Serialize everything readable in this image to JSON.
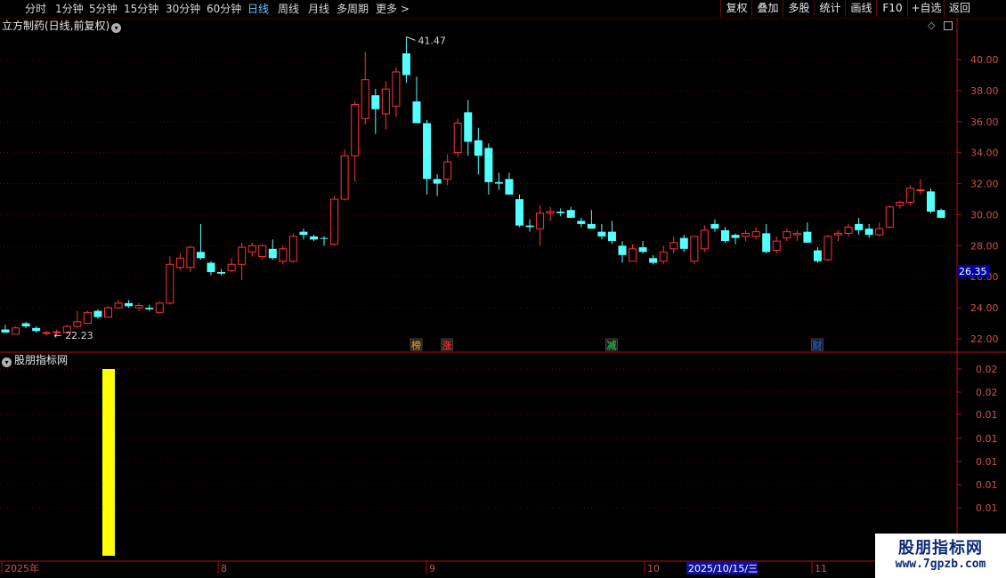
{
  "toolbar": {
    "periods": [
      "分时",
      "1分钟",
      "5分钟",
      "15分钟",
      "30分钟",
      "60分钟",
      "日线",
      "周线",
      "月线",
      "多周期",
      "更多"
    ],
    "more_arrow": ">",
    "selected_period": "日线",
    "right_buttons": [
      "复权",
      "叠加",
      "多股",
      "统计",
      "画线",
      "F10",
      "+自选",
      "返回"
    ]
  },
  "chart_header": {
    "title": "立方制药(日线,前复权)",
    "dropdown_icon": "chevron-down-icon"
  },
  "price_axis": {
    "ticks": [
      "40.00",
      "38.00",
      "36.00",
      "34.00",
      "32.00",
      "30.00",
      "28.00",
      "26.00",
      "24.00",
      "22.00"
    ],
    "current_price_label": "26.35"
  },
  "annotations": {
    "high_label": "41.47",
    "low_label": "22.23",
    "event_markers": [
      "榜",
      "涨",
      "减",
      "财"
    ]
  },
  "indicator_panel": {
    "title": "股朋指标网",
    "axis_ticks": [
      "0.02",
      "0.02",
      "0.01",
      "0.01",
      "0.01",
      "0.01",
      "0.01"
    ]
  },
  "time_axis": {
    "labels": [
      "2025年",
      "8",
      "9",
      "10",
      "11"
    ],
    "cursor_date": "2025/10/15/三"
  },
  "watermark": {
    "line1": "股朋指标网",
    "line2": "www.7gpzb.com"
  },
  "colors": {
    "up": "#ff3333",
    "down": "#54ffff",
    "grid": "#6a0000",
    "indicator_bar": "#ffff00",
    "current_price_bg": "#0000a8"
  },
  "chart_data": {
    "type": "candlestick",
    "title": "立方制药(日线,前复权)",
    "ylim": [
      21.2,
      42.5
    ],
    "yticks": [
      22,
      24,
      26,
      28,
      30,
      32,
      34,
      36,
      38,
      40
    ],
    "x_labels": [
      "2025年",
      "8",
      "9",
      "10",
      "11"
    ],
    "candles": [
      {
        "o": 22.6,
        "h": 22.9,
        "l": 22.4,
        "c": 22.4
      },
      {
        "o": 22.3,
        "h": 22.8,
        "l": 22.3,
        "c": 22.7
      },
      {
        "o": 23.0,
        "h": 23.1,
        "l": 22.7,
        "c": 22.8
      },
      {
        "o": 22.7,
        "h": 22.8,
        "l": 22.4,
        "c": 22.5
      },
      {
        "o": 22.4,
        "h": 22.5,
        "l": 22.23,
        "c": 22.4
      },
      {
        "o": 22.4,
        "h": 22.6,
        "l": 22.23,
        "c": 22.45
      },
      {
        "o": 22.4,
        "h": 22.9,
        "l": 22.3,
        "c": 22.8
      },
      {
        "o": 22.8,
        "h": 23.8,
        "l": 22.7,
        "c": 23.1
      },
      {
        "o": 23.0,
        "h": 23.8,
        "l": 23.0,
        "c": 23.7
      },
      {
        "o": 23.8,
        "h": 23.9,
        "l": 23.3,
        "c": 23.4
      },
      {
        "o": 23.4,
        "h": 24.1,
        "l": 23.4,
        "c": 24.0
      },
      {
        "o": 24.0,
        "h": 24.5,
        "l": 23.9,
        "c": 24.3
      },
      {
        "o": 24.3,
        "h": 24.5,
        "l": 24.0,
        "c": 24.1
      },
      {
        "o": 24.0,
        "h": 24.3,
        "l": 23.8,
        "c": 24.15
      },
      {
        "o": 24.0,
        "h": 24.2,
        "l": 23.8,
        "c": 23.9
      },
      {
        "o": 23.7,
        "h": 24.4,
        "l": 23.7,
        "c": 24.3
      },
      {
        "o": 24.3,
        "h": 27.3,
        "l": 24.2,
        "c": 26.8
      },
      {
        "o": 26.6,
        "h": 27.5,
        "l": 26.4,
        "c": 27.2
      },
      {
        "o": 26.6,
        "h": 28.0,
        "l": 26.3,
        "c": 27.9
      },
      {
        "o": 27.6,
        "h": 29.4,
        "l": 27.1,
        "c": 27.2
      },
      {
        "o": 26.9,
        "h": 27.0,
        "l": 26.1,
        "c": 26.3
      },
      {
        "o": 26.3,
        "h": 26.5,
        "l": 26.1,
        "c": 26.2
      },
      {
        "o": 26.4,
        "h": 27.2,
        "l": 26.3,
        "c": 26.8
      },
      {
        "o": 26.8,
        "h": 28.2,
        "l": 25.8,
        "c": 27.9
      },
      {
        "o": 27.6,
        "h": 28.2,
        "l": 27.3,
        "c": 28.0
      },
      {
        "o": 27.3,
        "h": 28.1,
        "l": 27.1,
        "c": 28.0
      },
      {
        "o": 27.8,
        "h": 28.4,
        "l": 27.1,
        "c": 27.2
      },
      {
        "o": 27.0,
        "h": 28.0,
        "l": 26.8,
        "c": 27.8
      },
      {
        "o": 27.0,
        "h": 28.8,
        "l": 26.9,
        "c": 28.6
      },
      {
        "o": 28.9,
        "h": 29.1,
        "l": 28.4,
        "c": 28.7
      },
      {
        "o": 28.6,
        "h": 28.7,
        "l": 28.3,
        "c": 28.4
      },
      {
        "o": 28.5,
        "h": 28.6,
        "l": 28.0,
        "c": 28.45
      },
      {
        "o": 28.1,
        "h": 31.2,
        "l": 28.0,
        "c": 31.0
      },
      {
        "o": 31.0,
        "h": 34.2,
        "l": 30.9,
        "c": 33.8
      },
      {
        "o": 33.8,
        "h": 37.3,
        "l": 32.1,
        "c": 37.1
      },
      {
        "o": 36.2,
        "h": 40.5,
        "l": 35.8,
        "c": 38.7
      },
      {
        "o": 37.7,
        "h": 38.1,
        "l": 35.2,
        "c": 36.8
      },
      {
        "o": 36.5,
        "h": 38.6,
        "l": 35.5,
        "c": 38.1
      },
      {
        "o": 37.0,
        "h": 39.5,
        "l": 36.3,
        "c": 39.2
      },
      {
        "o": 40.4,
        "h": 41.47,
        "l": 38.5,
        "c": 39.0
      },
      {
        "o": 37.3,
        "h": 38.9,
        "l": 36.3,
        "c": 35.9
      },
      {
        "o": 35.9,
        "h": 36.1,
        "l": 31.3,
        "c": 32.3
      },
      {
        "o": 32.3,
        "h": 32.6,
        "l": 31.2,
        "c": 32.0
      },
      {
        "o": 32.3,
        "h": 33.9,
        "l": 31.9,
        "c": 33.4
      },
      {
        "o": 34.0,
        "h": 36.2,
        "l": 33.7,
        "c": 35.9
      },
      {
        "o": 36.6,
        "h": 37.4,
        "l": 33.8,
        "c": 34.7
      },
      {
        "o": 34.8,
        "h": 35.6,
        "l": 32.6,
        "c": 33.8
      },
      {
        "o": 34.3,
        "h": 34.6,
        "l": 31.3,
        "c": 32.1
      },
      {
        "o": 32.1,
        "h": 32.7,
        "l": 31.6,
        "c": 32.0
      },
      {
        "o": 32.3,
        "h": 32.7,
        "l": 31.3,
        "c": 31.3
      },
      {
        "o": 31.0,
        "h": 31.3,
        "l": 29.2,
        "c": 29.3
      },
      {
        "o": 29.3,
        "h": 29.7,
        "l": 28.9,
        "c": 29.2
      },
      {
        "o": 29.1,
        "h": 30.6,
        "l": 28.0,
        "c": 30.1
      },
      {
        "o": 30.1,
        "h": 30.5,
        "l": 29.6,
        "c": 30.2
      },
      {
        "o": 30.2,
        "h": 30.4,
        "l": 29.9,
        "c": 30.1
      },
      {
        "o": 30.3,
        "h": 30.5,
        "l": 29.8,
        "c": 29.8
      },
      {
        "o": 29.6,
        "h": 29.8,
        "l": 29.2,
        "c": 29.4
      },
      {
        "o": 29.4,
        "h": 30.3,
        "l": 29.1,
        "c": 29.1
      },
      {
        "o": 28.9,
        "h": 29.4,
        "l": 28.4,
        "c": 28.6
      },
      {
        "o": 28.9,
        "h": 29.6,
        "l": 28.1,
        "c": 28.3
      },
      {
        "o": 28.0,
        "h": 28.3,
        "l": 26.9,
        "c": 27.4
      },
      {
        "o": 27.0,
        "h": 28.1,
        "l": 27.0,
        "c": 27.8
      },
      {
        "o": 27.9,
        "h": 28.3,
        "l": 27.5,
        "c": 27.6
      },
      {
        "o": 27.2,
        "h": 27.4,
        "l": 26.8,
        "c": 26.9
      },
      {
        "o": 27.0,
        "h": 28.0,
        "l": 26.8,
        "c": 27.6
      },
      {
        "o": 27.8,
        "h": 28.6,
        "l": 27.5,
        "c": 28.2
      },
      {
        "o": 28.5,
        "h": 28.7,
        "l": 27.6,
        "c": 27.8
      },
      {
        "o": 27.0,
        "h": 28.6,
        "l": 26.8,
        "c": 28.6
      },
      {
        "o": 27.8,
        "h": 29.3,
        "l": 27.6,
        "c": 29.0
      },
      {
        "o": 29.4,
        "h": 29.7,
        "l": 28.9,
        "c": 29.1
      },
      {
        "o": 29.0,
        "h": 29.2,
        "l": 28.2,
        "c": 28.3
      },
      {
        "o": 28.7,
        "h": 28.8,
        "l": 28.1,
        "c": 28.5
      },
      {
        "o": 28.6,
        "h": 29.0,
        "l": 28.3,
        "c": 28.8
      },
      {
        "o": 28.6,
        "h": 29.2,
        "l": 28.4,
        "c": 28.9
      },
      {
        "o": 28.8,
        "h": 29.4,
        "l": 27.5,
        "c": 27.6
      },
      {
        "o": 27.7,
        "h": 28.6,
        "l": 27.5,
        "c": 28.3
      },
      {
        "o": 28.5,
        "h": 29.1,
        "l": 28.3,
        "c": 28.9
      },
      {
        "o": 28.7,
        "h": 29.0,
        "l": 28.3,
        "c": 28.8
      },
      {
        "o": 28.9,
        "h": 29.5,
        "l": 28.2,
        "c": 28.2
      },
      {
        "o": 27.7,
        "h": 27.9,
        "l": 26.9,
        "c": 27.0
      },
      {
        "o": 27.1,
        "h": 28.7,
        "l": 27.0,
        "c": 28.6
      },
      {
        "o": 28.7,
        "h": 29.0,
        "l": 28.3,
        "c": 28.8
      },
      {
        "o": 28.8,
        "h": 29.4,
        "l": 28.6,
        "c": 29.2
      },
      {
        "o": 29.4,
        "h": 29.8,
        "l": 28.7,
        "c": 29.0
      },
      {
        "o": 29.1,
        "h": 29.4,
        "l": 28.5,
        "c": 28.7
      },
      {
        "o": 28.7,
        "h": 29.5,
        "l": 28.6,
        "c": 29.1
      },
      {
        "o": 29.2,
        "h": 30.6,
        "l": 29.1,
        "c": 30.5
      },
      {
        "o": 30.6,
        "h": 30.9,
        "l": 30.4,
        "c": 30.8
      },
      {
        "o": 30.8,
        "h": 31.9,
        "l": 30.6,
        "c": 31.7
      },
      {
        "o": 31.6,
        "h": 32.3,
        "l": 31.3,
        "c": 31.6
      },
      {
        "o": 31.5,
        "h": 31.7,
        "l": 30.1,
        "c": 30.2
      },
      {
        "o": 30.3,
        "h": 30.4,
        "l": 29.8,
        "c": 29.8
      }
    ],
    "markers": [
      {
        "index": 40,
        "text": "榜"
      },
      {
        "index": 43,
        "text": "涨"
      },
      {
        "index": 59,
        "text": "减"
      },
      {
        "index": 79,
        "text": "财"
      }
    ],
    "indicator": {
      "bar_index": 10,
      "value": 0.02,
      "ylim": [
        0,
        0.02
      ]
    }
  }
}
